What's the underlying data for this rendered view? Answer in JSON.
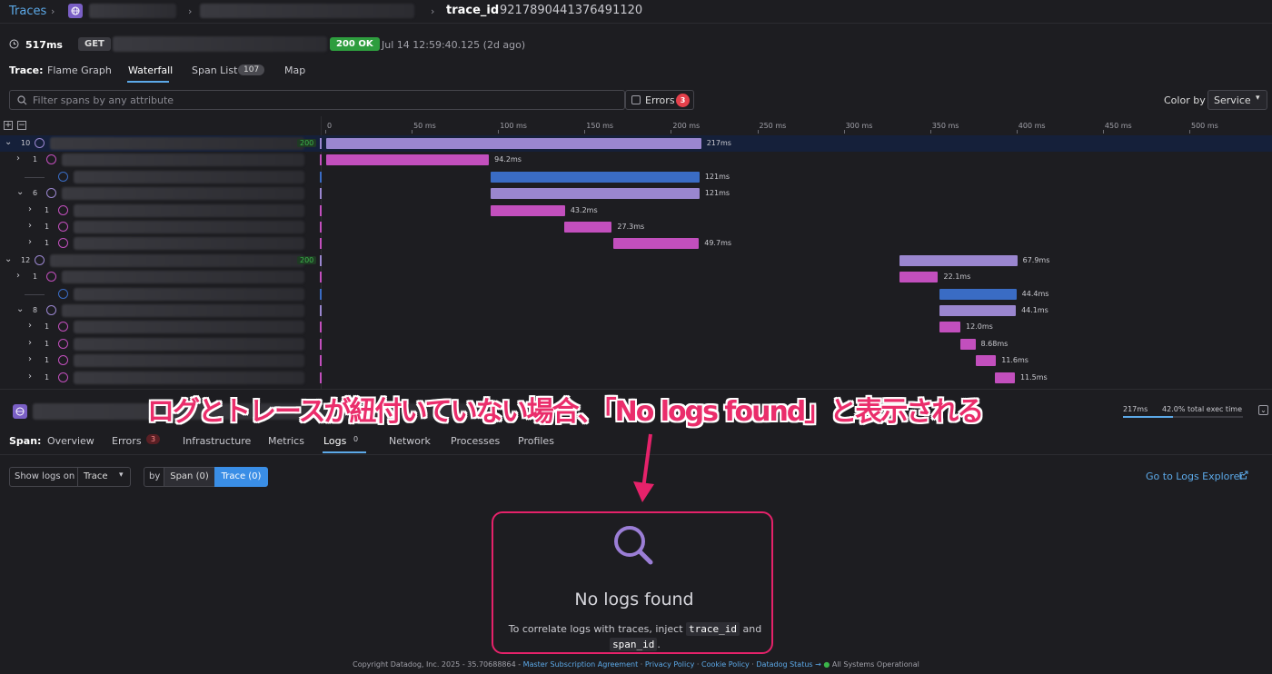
{
  "breadcrumb": {
    "root": "Traces",
    "trace_key": "trace_id",
    "trace_value": "9217890441376491120"
  },
  "summary": {
    "duration": "517ms",
    "method": "GET",
    "status": "200 OK",
    "timestamp": "Jul 14 12:59:40.125 (2d ago)"
  },
  "trace_tabs": {
    "label": "Trace:",
    "tabs": [
      {
        "label": "Flame Graph"
      },
      {
        "label": "Waterfall",
        "active": true
      },
      {
        "label": "Span List",
        "count": "107"
      },
      {
        "label": "Map"
      }
    ]
  },
  "filter": {
    "placeholder": "Filter spans by any attribute",
    "errors_label": "Errors",
    "errors_count": "3",
    "color_by_label": "Color by",
    "color_by_value": "Service"
  },
  "axis": {
    "ticks": [
      "0",
      "50 ms",
      "100 ms",
      "150 ms",
      "200 ms",
      "250 ms",
      "300 ms",
      "350 ms",
      "400 ms",
      "450 ms",
      "500 ms"
    ]
  },
  "spans": [
    {
      "count": "10",
      "status": "200",
      "start": 0,
      "duration_ms": 217,
      "label": "217ms",
      "service": "root",
      "level": 0,
      "expanded": true
    },
    {
      "count": "1",
      "start": 0,
      "duration_ms": 94.2,
      "label": "94.2ms",
      "service": "child",
      "level": 1
    },
    {
      "count": "",
      "start": 95,
      "duration_ms": 121,
      "label": "121ms",
      "service": "db",
      "level": 2
    },
    {
      "count": "6",
      "start": 95,
      "duration_ms": 121,
      "label": "121ms",
      "service": "root",
      "level": 1,
      "expanded": true
    },
    {
      "count": "1",
      "start": 95,
      "duration_ms": 43.2,
      "label": "43.2ms",
      "service": "child",
      "level": 2
    },
    {
      "count": "1",
      "start": 138,
      "duration_ms": 27.3,
      "label": "27.3ms",
      "service": "child",
      "level": 2
    },
    {
      "count": "1",
      "start": 166,
      "duration_ms": 49.7,
      "label": "49.7ms",
      "service": "child",
      "level": 2
    },
    {
      "count": "12",
      "status": "200",
      "start": 332,
      "duration_ms": 67.9,
      "label": "67.9ms",
      "service": "root",
      "level": 0,
      "expanded": true
    },
    {
      "count": "1",
      "start": 332,
      "duration_ms": 22.1,
      "label": "22.1ms",
      "service": "child",
      "level": 1
    },
    {
      "count": "",
      "start": 355,
      "duration_ms": 44.4,
      "label": "44.4ms",
      "service": "db",
      "level": 2
    },
    {
      "count": "8",
      "start": 355,
      "duration_ms": 44.1,
      "label": "44.1ms",
      "service": "root",
      "level": 1,
      "expanded": true
    },
    {
      "count": "1",
      "start": 355,
      "duration_ms": 12.0,
      "label": "12.0ms",
      "service": "child",
      "level": 2
    },
    {
      "count": "1",
      "start": 367,
      "duration_ms": 8.68,
      "label": "8.68ms",
      "service": "child",
      "level": 2
    },
    {
      "count": "1",
      "start": 376,
      "duration_ms": 11.6,
      "label": "11.6ms",
      "service": "child",
      "level": 2
    },
    {
      "count": "1",
      "start": 387,
      "duration_ms": 11.5,
      "label": "11.5ms",
      "service": "child",
      "level": 2
    }
  ],
  "span_info": {
    "duration": "217ms",
    "exec_time": "42.0% total exec time"
  },
  "annotation": {
    "text": "ログとトレースが紐付いていない場合、「No logs found」と表示される"
  },
  "span_tabs": {
    "label": "Span:",
    "tabs": [
      {
        "label": "Overview"
      },
      {
        "label": "Errors",
        "count": "3"
      },
      {
        "label": "Infrastructure"
      },
      {
        "label": "Metrics"
      },
      {
        "label": "Logs",
        "count": "0",
        "active": true
      },
      {
        "label": "Network"
      },
      {
        "label": "Processes"
      },
      {
        "label": "Profiles"
      }
    ]
  },
  "logs": {
    "show_on_label": "Show logs on",
    "show_on_value": "Trace",
    "by_label": "by",
    "span_btn": "Span (0)",
    "trace_btn": "Trace (0)",
    "explorer_link": "Go to Logs Explorer",
    "empty_title": "No logs found",
    "empty_text": "To correlate logs with traces, inject",
    "code1": "trace_id",
    "and": "and",
    "code2": "span_id",
    "dot": "."
  },
  "footer": {
    "copyright": "Copyright Datadog, Inc. 2025 - 35.70688864 -",
    "msa": "Master Subscription Agreement",
    "privacy": "Privacy Policy",
    "cookie": "Cookie Policy",
    "status": "Datadog Status →",
    "ops": "All Systems Operational"
  },
  "colors": {
    "root": "#9a86cf",
    "child": "#c24fbd",
    "db": "#3a6cc4",
    "accent": "#5ca9e8",
    "annotation": "#ea2d6b"
  }
}
